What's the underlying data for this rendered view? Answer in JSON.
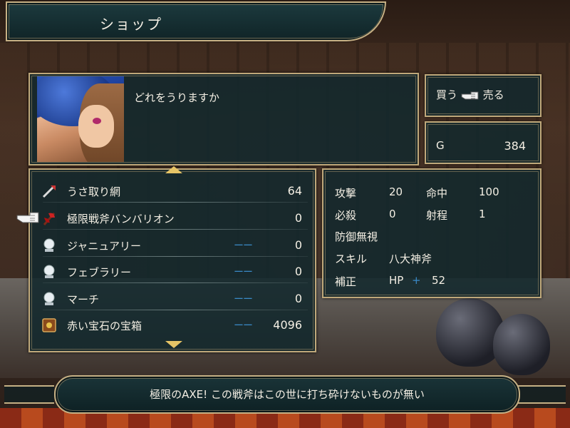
{
  "window": {
    "title": "ショップ"
  },
  "message": "どれをうりますか",
  "mode": {
    "buy_label": "買う",
    "sell_label": "売る",
    "selected": "売る",
    "pointer_icon": "pointing-hand-icon"
  },
  "gold": {
    "label": "G",
    "value": "384"
  },
  "items": [
    {
      "name": "うさ取り網",
      "dash": "",
      "count": "64",
      "icon": "net-icon"
    },
    {
      "name": "極限戦斧バンバリオン",
      "dash": "",
      "count": "0",
      "icon": "axe-icon"
    },
    {
      "name": "ジャニュアリー",
      "dash": "ーー",
      "count": "0",
      "icon": "crystal-orb-icon"
    },
    {
      "name": "フェブラリー",
      "dash": "ーー",
      "count": "0",
      "icon": "crystal-orb-icon"
    },
    {
      "name": "マーチ",
      "dash": "ーー",
      "count": "0",
      "icon": "crystal-orb-icon"
    },
    {
      "name": "赤い宝石の宝箱",
      "dash": "ーー",
      "count": "4096",
      "icon": "treasure-box-icon"
    }
  ],
  "selected_index": 1,
  "stats": {
    "attack_label": "攻撃",
    "attack_value": "20",
    "hit_label": "命中",
    "hit_value": "100",
    "crit_label": "必殺",
    "crit_value": "0",
    "range_label": "射程",
    "range_value": "1",
    "special": "防御無視",
    "skill_label": "スキル",
    "skill_value": "八大神斧",
    "bonus_label": "補正",
    "bonus_stat": "HP",
    "bonus_sign": "+",
    "bonus_value": "52"
  },
  "description": "極限のAXE! この戦斧はこの世に打ち砕けないものが無い",
  "colors": {
    "panel_bg": "#12282c",
    "frame_gold": "#bfa87a",
    "dash_blue": "#3a8ac8",
    "arrow_gold": "#e6c466"
  }
}
